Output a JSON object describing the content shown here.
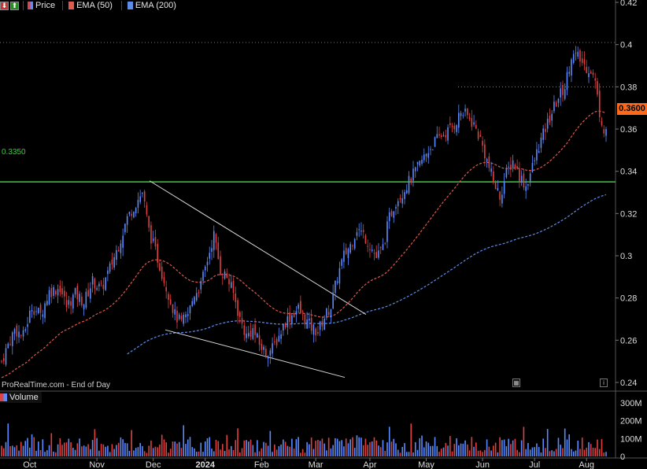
{
  "toolbar": {
    "price_label": "Price",
    "ema50_label": "EMA (50)",
    "ema200_label": "EMA (200)"
  },
  "watermark": "ProRealTime.com - End of Day",
  "volume_label": "Volume",
  "last_price": "0.3600",
  "level_label": "0.3350",
  "colors": {
    "up": "#5a8cff",
    "down": "#e04040",
    "ema50": "#e05a4e",
    "ema200": "#5c8ee8",
    "support": "#3ccb3c",
    "trendline": "#d8d8d8",
    "last_price_bg": "#ff6a1a"
  },
  "chart_data": [
    {
      "type": "candlestick",
      "title": "",
      "x": [
        "Oct",
        "Nov",
        "Dec",
        "2024",
        "Feb",
        "Mar",
        "Apr",
        "May",
        "Jun",
        "Jul",
        "Aug"
      ],
      "ylim": [
        0.24,
        0.42
      ],
      "yticks": [
        "0.42",
        "0.4",
        "0.38",
        "0.36",
        "0.34",
        "0.32",
        "0.3",
        "0.28",
        "0.26",
        "0.24"
      ],
      "grid": false,
      "series": [
        {
          "name": "Price",
          "close_path": [
            [
              0,
              0.25
            ],
            [
              3,
              0.258
            ],
            [
              6,
              0.265
            ],
            [
              10,
              0.262
            ],
            [
              14,
              0.276
            ],
            [
              18,
              0.272
            ],
            [
              22,
              0.283
            ],
            [
              27,
              0.285
            ],
            [
              30,
              0.276
            ],
            [
              34,
              0.282
            ],
            [
              38,
              0.278
            ],
            [
              42,
              0.288
            ],
            [
              46,
              0.284
            ],
            [
              50,
              0.294
            ],
            [
              54,
              0.305
            ],
            [
              58,
              0.318
            ],
            [
              62,
              0.325
            ],
            [
              65,
              0.33
            ],
            [
              68,
              0.312
            ],
            [
              71,
              0.302
            ],
            [
              74,
              0.292
            ],
            [
              77,
              0.282
            ],
            [
              80,
              0.272
            ],
            [
              83,
              0.268
            ],
            [
              86,
              0.272
            ],
            [
              89,
              0.282
            ],
            [
              92,
              0.286
            ],
            [
              95,
              0.298
            ],
            [
              98,
              0.31
            ],
            [
              101,
              0.293
            ],
            [
              104,
              0.29
            ],
            [
              107,
              0.282
            ],
            [
              110,
              0.27
            ],
            [
              113,
              0.262
            ],
            [
              116,
              0.265
            ],
            [
              119,
              0.258
            ],
            [
              122,
              0.254
            ],
            [
              125,
              0.256
            ],
            [
              128,
              0.262
            ],
            [
              131,
              0.269
            ],
            [
              134,
              0.272
            ],
            [
              137,
              0.275
            ],
            [
              140,
              0.27
            ],
            [
              143,
              0.266
            ],
            [
              146,
              0.264
            ],
            [
              149,
              0.271
            ],
            [
              152,
              0.276
            ],
            [
              155,
              0.29
            ],
            [
              158,
              0.3
            ],
            [
              161,
              0.305
            ],
            [
              164,
              0.313
            ],
            [
              167,
              0.31
            ],
            [
              170,
              0.305
            ],
            [
              173,
              0.299
            ],
            [
              176,
              0.304
            ],
            [
              179,
              0.318
            ],
            [
              182,
              0.326
            ],
            [
              185,
              0.33
            ],
            [
              188,
              0.335
            ],
            [
              191,
              0.34
            ],
            [
              194,
              0.345
            ],
            [
              197,
              0.35
            ],
            [
              200,
              0.354
            ],
            [
              203,
              0.357
            ],
            [
              206,
              0.359
            ],
            [
              209,
              0.362
            ],
            [
              212,
              0.368
            ],
            [
              215,
              0.366
            ],
            [
              218,
              0.362
            ],
            [
              221,
              0.355
            ],
            [
              224,
              0.345
            ],
            [
              227,
              0.335
            ],
            [
              230,
              0.328
            ],
            [
              233,
              0.339
            ],
            [
              236,
              0.345
            ],
            [
              239,
              0.338
            ],
            [
              242,
              0.333
            ],
            [
              245,
              0.342
            ],
            [
              248,
              0.352
            ],
            [
              251,
              0.36
            ],
            [
              254,
              0.368
            ],
            [
              257,
              0.375
            ],
            [
              260,
              0.38
            ],
            [
              263,
              0.395
            ],
            [
              266,
              0.394
            ],
            [
              269,
              0.39
            ],
            [
              272,
              0.388
            ],
            [
              274,
              0.382
            ],
            [
              276,
              0.368
            ],
            [
              278,
              0.36
            ]
          ]
        },
        {
          "name": "EMA (50)",
          "start": 0.241,
          "end": 0.366
        },
        {
          "name": "EMA (200)",
          "start": 0.228,
          "end": 0.317
        }
      ],
      "annotations": {
        "support_level": 0.335,
        "resistance_dotted": [
          0.401,
          0.38
        ],
        "last_price": 0.36
      }
    },
    {
      "type": "bar",
      "title": "Volume",
      "ylim": [
        0,
        300000000
      ],
      "yticks": [
        "300M",
        "200M",
        "100M",
        "0"
      ]
    }
  ]
}
